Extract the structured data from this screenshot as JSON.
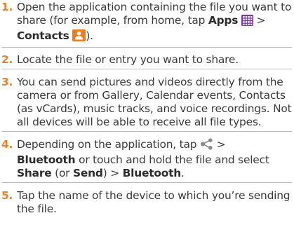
{
  "steps": [
    {
      "num": "1.",
      "t1": "Open the application containing the file you want to share (for example, from home, tap ",
      "b1": "Apps",
      "t2": " > ",
      "b2": "Contacts",
      "t3": ")."
    },
    {
      "num": "2.",
      "text": "Locate the file or entry you want to share."
    },
    {
      "num": "3.",
      "text": "You can send pictures and videos directly from the camera or from Gallery, Calendar events, Contacts (as vCards), music tracks, and voice recordings. Not all devices will be able to receive all file types."
    },
    {
      "num": "4.",
      "t1": "Depending on the application, tap ",
      "t2": " > ",
      "b1": "Bluetooth",
      "t3": " or touch and hold the file and select ",
      "b2": "Share",
      "t4": " (or ",
      "b3": "Send",
      "t5": ") > ",
      "b4": "Bluetooth",
      "t6": "."
    },
    {
      "num": "5.",
      "text": "Tap the name of the device to which you’re sending the file."
    }
  ],
  "icons": {
    "apps": "apps-grid-icon",
    "contacts": "contacts-person-icon",
    "share": "share-icon"
  },
  "colors": {
    "step_number": "#e8812a",
    "apps_icon": "#7b35a8",
    "contacts_icon": "#f07d1a",
    "share_icon": "#8a8a8a",
    "divider": "#bdbdbd"
  }
}
